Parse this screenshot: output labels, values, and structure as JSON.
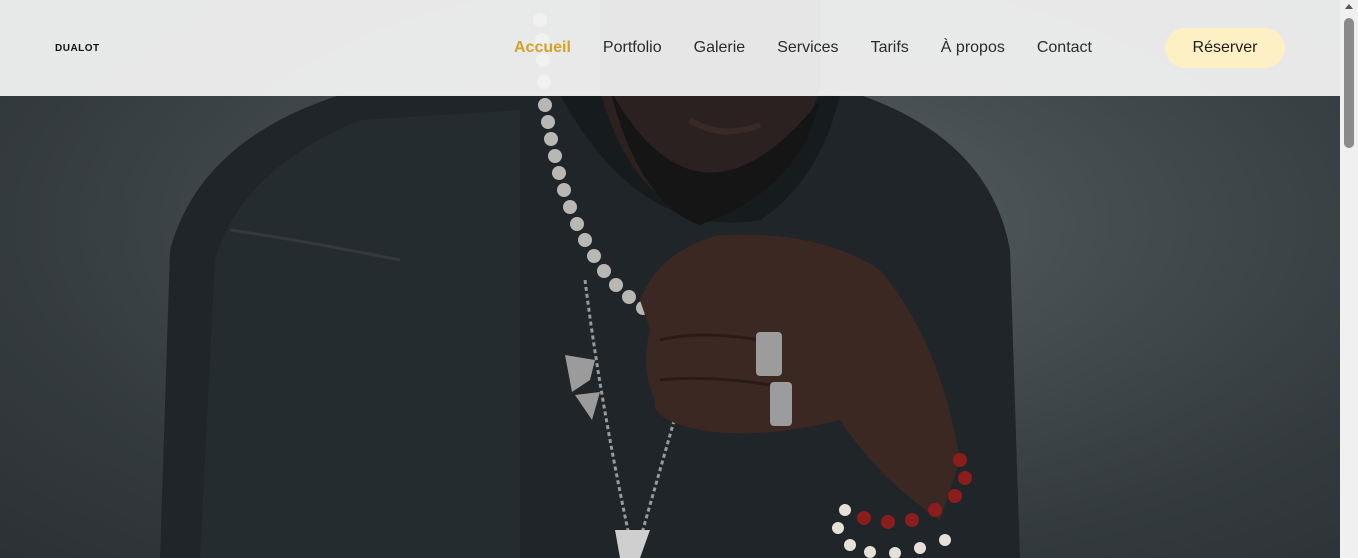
{
  "brand": {
    "logo_text": "DUALOT"
  },
  "nav": {
    "items": [
      {
        "label": "Accueil",
        "active": true
      },
      {
        "label": "Portfolio",
        "active": false
      },
      {
        "label": "Galerie",
        "active": false
      },
      {
        "label": "Services",
        "active": false
      },
      {
        "label": "Tarifs",
        "active": false
      },
      {
        "label": "À propos",
        "active": false
      },
      {
        "label": "Contact",
        "active": false
      }
    ]
  },
  "cta": {
    "label": "Réserver"
  },
  "colors": {
    "accent": "#d4a227",
    "cta_bg": "#fdf0c4",
    "header_bg": "#f5f5f5"
  },
  "hero": {
    "image": "portrait-man-black-sweatshirt-pearl-necklace"
  }
}
